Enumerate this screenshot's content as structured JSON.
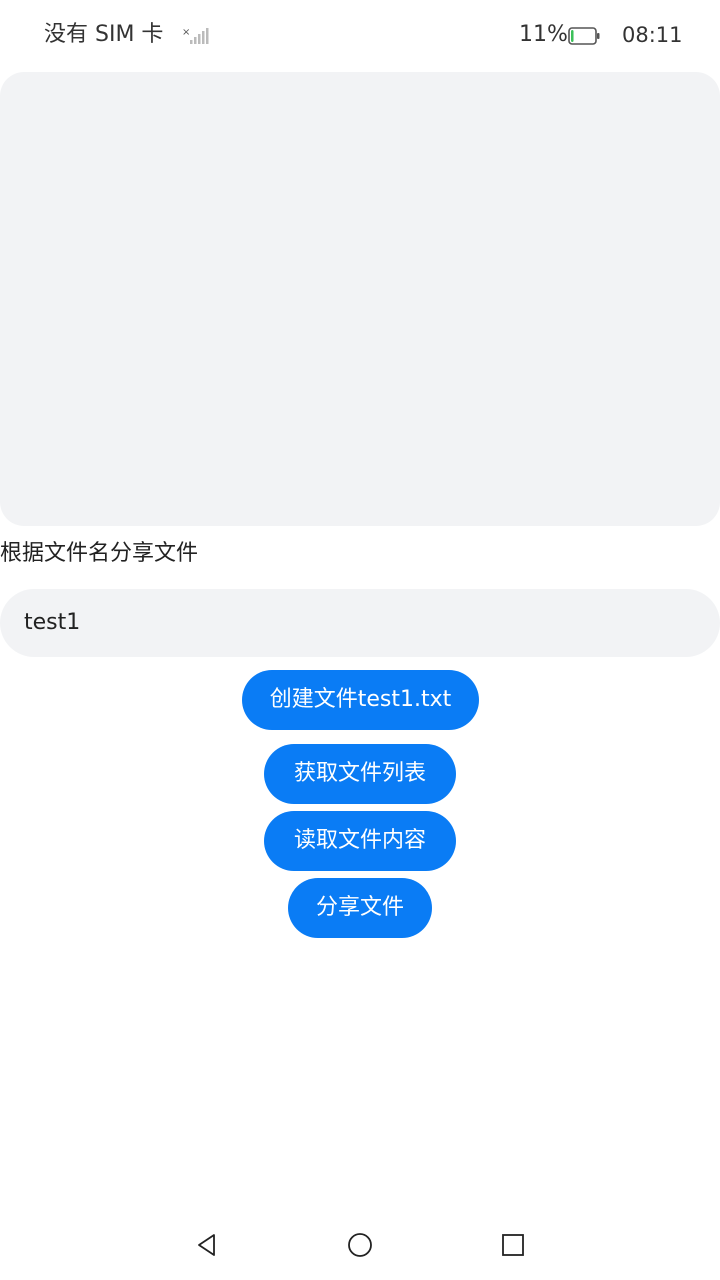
{
  "status_bar": {
    "carrier": "没有 SIM 卡",
    "battery_percent": "11%",
    "battery_level": 0.11,
    "time": "08:11"
  },
  "main": {
    "section_label": "根据文件名分享文件",
    "filename_value": "test1",
    "buttons": {
      "create": "创建文件test1.txt",
      "list": "获取文件列表",
      "read": "读取文件内容",
      "share": "分享文件"
    }
  },
  "colors": {
    "accent": "#0a7cf5",
    "panel": "#f2f3f5"
  },
  "nav": {
    "icons": [
      "back-icon",
      "home-icon",
      "recents-icon"
    ]
  }
}
